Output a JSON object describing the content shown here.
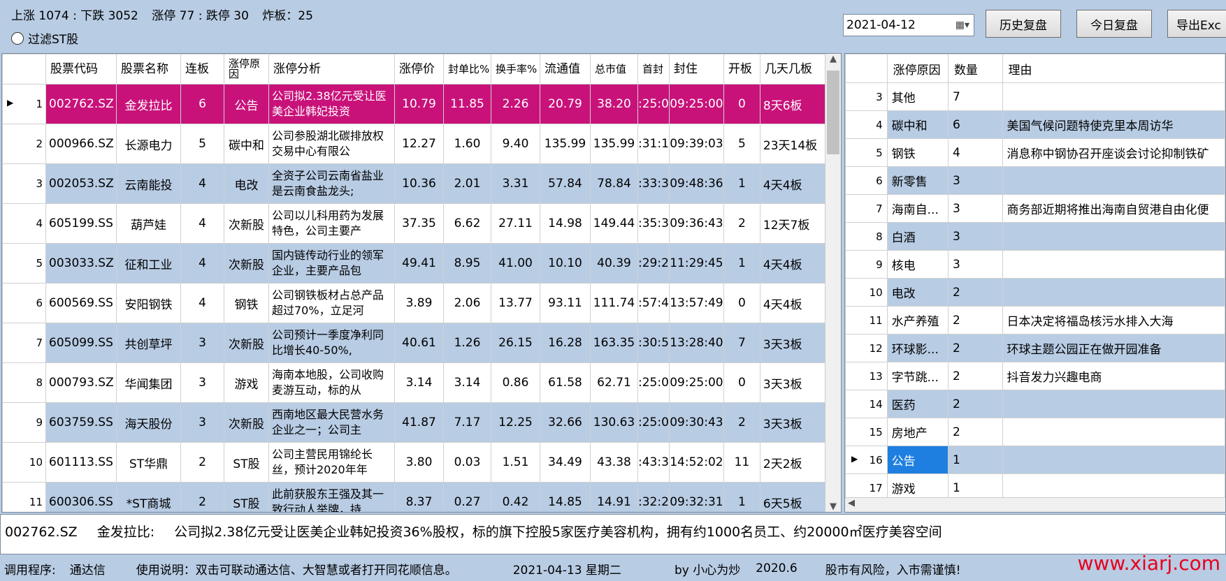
{
  "top": {
    "up_down": "上涨 1074 : 下跌 3052",
    "limit": "涨停 77 : 跌停 30",
    "broken": "炸板：25",
    "filter_st": "过滤ST股"
  },
  "toolbar": {
    "date": "2021-04-12",
    "history_btn": "历史复盘",
    "today_btn": "今日复盘",
    "export_btn": "导出Exc"
  },
  "main_table": {
    "headers": [
      "股票代码",
      "股票名称",
      "连板",
      "涨停原因",
      "涨停分析",
      "涨停价",
      "封单比%",
      "换手率%",
      "流通值",
      "总市值",
      "首封",
      "封住",
      "开板",
      "几天几板"
    ],
    "rows": [
      {
        "idx": "1",
        "code": "002762.SZ",
        "name": "金发拉比",
        "lb": "6",
        "reason": "公告",
        "analysis": "公司拟2.38亿元受让医美企业韩妃投资",
        "price": "10.79",
        "fd": "11.85",
        "hs": "2.26",
        "ltz": "20.79",
        "zsz": "38.20",
        "sf": ":25:0",
        "fz": "09:25:00",
        "kb": "0",
        "jt": "8天6板"
      },
      {
        "idx": "2",
        "code": "000966.SZ",
        "name": "长源电力",
        "lb": "5",
        "reason": "碳中和",
        "analysis": "公司参股湖北碳排放权交易中心有限公",
        "price": "12.27",
        "fd": "1.60",
        "hs": "9.40",
        "ltz": "135.99",
        "zsz": "135.99",
        "sf": ":31:1",
        "fz": "09:39:03",
        "kb": "5",
        "jt": "23天14板"
      },
      {
        "idx": "3",
        "code": "002053.SZ",
        "name": "云南能投",
        "lb": "4",
        "reason": "电改",
        "analysis": "全资子公司云南省盐业是云南食盐龙头;",
        "price": "10.36",
        "fd": "2.01",
        "hs": "3.31",
        "ltz": "57.84",
        "zsz": "78.84",
        "sf": ":33:3",
        "fz": "09:48:36",
        "kb": "1",
        "jt": "4天4板"
      },
      {
        "idx": "4",
        "code": "605199.SS",
        "name": "葫芦娃",
        "lb": "4",
        "reason": "次新股",
        "analysis": "公司以儿科用药为发展特色，公司主要产",
        "price": "37.35",
        "fd": "6.62",
        "hs": "27.11",
        "ltz": "14.98",
        "zsz": "149.44",
        "sf": ":35:3",
        "fz": "09:36:43",
        "kb": "2",
        "jt": "12天7板"
      },
      {
        "idx": "5",
        "code": "003033.SZ",
        "name": "征和工业",
        "lb": "4",
        "reason": "次新股",
        "analysis": "国内链传动行业的领军企业，主要产品包",
        "price": "49.41",
        "fd": "8.95",
        "hs": "41.00",
        "ltz": "10.10",
        "zsz": "40.39",
        "sf": ":29:2",
        "fz": "11:29:45",
        "kb": "1",
        "jt": "4天4板"
      },
      {
        "idx": "6",
        "code": "600569.SS",
        "name": "安阳钢铁",
        "lb": "4",
        "reason": "钢铁",
        "analysis": "公司钢铁板材占总产品超过70%，立足河",
        "price": "3.89",
        "fd": "2.06",
        "hs": "13.77",
        "ltz": "93.11",
        "zsz": "111.74",
        "sf": ":57:4",
        "fz": "13:57:49",
        "kb": "0",
        "jt": "4天4板"
      },
      {
        "idx": "7",
        "code": "605099.SS",
        "name": "共创草坪",
        "lb": "3",
        "reason": "次新股",
        "analysis": "公司预计一季度净利同比增长40-50%,",
        "price": "40.61",
        "fd": "1.26",
        "hs": "26.15",
        "ltz": "16.28",
        "zsz": "163.35",
        "sf": ":30:5",
        "fz": "13:28:40",
        "kb": "7",
        "jt": "3天3板"
      },
      {
        "idx": "8",
        "code": "000793.SZ",
        "name": "华闻集团",
        "lb": "3",
        "reason": "游戏",
        "analysis": "海南本地股，公司收购麦游互动，标的从",
        "price": "3.14",
        "fd": "3.14",
        "hs": "0.86",
        "ltz": "61.58",
        "zsz": "62.71",
        "sf": ":25:0",
        "fz": "09:25:00",
        "kb": "0",
        "jt": "3天3板"
      },
      {
        "idx": "9",
        "code": "603759.SS",
        "name": "海天股份",
        "lb": "3",
        "reason": "次新股",
        "analysis": "西南地区最大民营水务企业之一；公司主",
        "price": "41.87",
        "fd": "7.17",
        "hs": "12.25",
        "ltz": "32.66",
        "zsz": "130.63",
        "sf": ":25:0",
        "fz": "09:30:43",
        "kb": "2",
        "jt": "3天3板"
      },
      {
        "idx": "10",
        "code": "601113.SS",
        "name": "ST华鼎",
        "lb": "2",
        "reason": "ST股",
        "analysis": "公司主营民用锦纶长丝，预计2020年年",
        "price": "3.80",
        "fd": "0.03",
        "hs": "1.51",
        "ltz": "34.49",
        "zsz": "43.38",
        "sf": ":43:3",
        "fz": "14:52:02",
        "kb": "11",
        "jt": "2天2板"
      },
      {
        "idx": "11",
        "code": "600306.SS",
        "name": "*ST商城",
        "lb": "2",
        "reason": "ST股",
        "analysis": "此前获股东王强及其一致行动人举牌，持",
        "price": "8.37",
        "fd": "0.27",
        "hs": "0.42",
        "ltz": "14.85",
        "zsz": "14.91",
        "sf": ":32:2",
        "fz": "09:32:31",
        "kb": "1",
        "jt": "6天5板"
      }
    ]
  },
  "right_table": {
    "headers": [
      "涨停原因",
      "数量",
      "理由"
    ],
    "rows": [
      {
        "idx": "3",
        "reason": "其他",
        "count": "7",
        "why": ""
      },
      {
        "idx": "4",
        "reason": "碳中和",
        "count": "6",
        "why": "美国气候问题特使克里本周访华"
      },
      {
        "idx": "5",
        "reason": "钢铁",
        "count": "4",
        "why": "消息称中钢协召开座谈会讨论抑制铁矿"
      },
      {
        "idx": "6",
        "reason": "新零售",
        "count": "3",
        "why": ""
      },
      {
        "idx": "7",
        "reason": "海南自...",
        "count": "3",
        "why": "商务部近期将推出海南自贸港自由化便"
      },
      {
        "idx": "8",
        "reason": "白酒",
        "count": "3",
        "why": ""
      },
      {
        "idx": "9",
        "reason": "核电",
        "count": "3",
        "why": ""
      },
      {
        "idx": "10",
        "reason": "电改",
        "count": "2",
        "why": ""
      },
      {
        "idx": "11",
        "reason": "水产养殖",
        "count": "2",
        "why": "日本决定将福岛核污水排入大海"
      },
      {
        "idx": "12",
        "reason": "环球影...",
        "count": "2",
        "why": "环球主题公园正在做开园准备"
      },
      {
        "idx": "13",
        "reason": "字节跳...",
        "count": "2",
        "why": "抖音发力兴趣电商"
      },
      {
        "idx": "14",
        "reason": "医药",
        "count": "2",
        "why": ""
      },
      {
        "idx": "15",
        "reason": "房地产",
        "count": "2",
        "why": ""
      },
      {
        "idx": "16",
        "reason": "公告",
        "count": "1",
        "why": ""
      },
      {
        "idx": "17",
        "reason": "游戏",
        "count": "1",
        "why": ""
      }
    ]
  },
  "detail": {
    "code": "002762.SZ",
    "name": "金发拉比:",
    "text": "公司拟2.38亿元受让医美企业韩妃投资36%股权，标的旗下控股5家医疗美容机构，拥有约1000名员工、约20000㎡医疗美容空间"
  },
  "status": {
    "program_label": "调用程序:",
    "program": "通达信",
    "usage": "使用说明：双击可联动通达信、大智慧或者打开同花顺信息。",
    "date": "2021-04-13 星期二",
    "author": "by 小心为炒",
    "version": "2020.6",
    "risk": "股市有风险，入市需谨慎!"
  },
  "watermark": "www.xiarj.com"
}
